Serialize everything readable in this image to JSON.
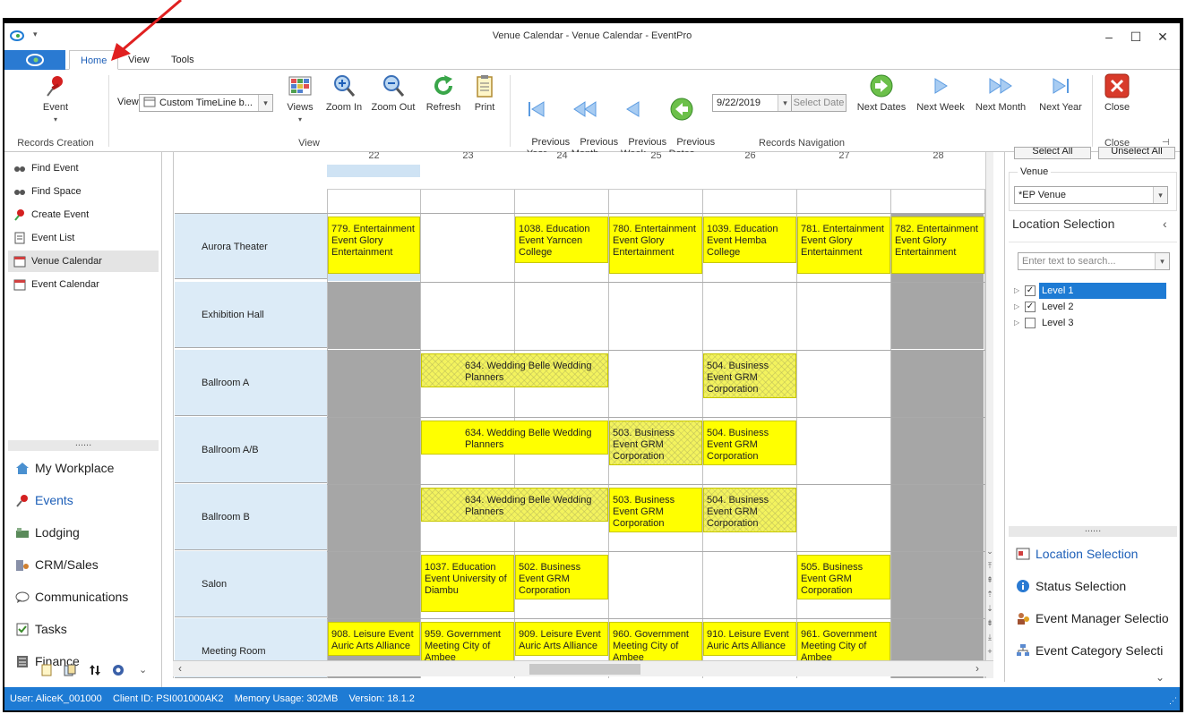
{
  "window": {
    "title": "Venue Calendar - Venue Calendar - EventPro"
  },
  "ribbon_tabs": [
    {
      "label": "Home"
    },
    {
      "label": "View"
    },
    {
      "label": "Tools"
    }
  ],
  "ribbon": {
    "event_label": "Event",
    "records_creation_label": "Records Creation",
    "view_label": "View",
    "view_combo_value": "Custom TimeLine b...",
    "views_label": "Views",
    "zoom_in_label": "Zoom In",
    "zoom_out_label": "Zoom Out",
    "refresh_label": "Refresh",
    "print_label": "Print",
    "view_group_label": "View",
    "prev_year_label": "Previous\nYear",
    "prev_month_label": "Previous\nMonth",
    "prev_week_label": "Previous\nWeek",
    "prev_dates_label": "Previous\nDates",
    "date_value": "9/22/2019",
    "select_date_label": "Select Date",
    "next_dates_label": "Next Dates",
    "next_week_label": "Next Week",
    "next_month_label": "Next Month",
    "next_year_label": "Next Year",
    "records_nav_label": "Records Navigation",
    "close_label": "Close",
    "close_group_label": "Close"
  },
  "left_nav": {
    "items": [
      {
        "label": "Find Event",
        "icon": "binoculars-icon"
      },
      {
        "label": "Find Space",
        "icon": "binoculars-icon"
      },
      {
        "label": "Create Event",
        "icon": "create-event-icon"
      },
      {
        "label": "Event List",
        "icon": "list-icon"
      },
      {
        "label": "Venue Calendar",
        "icon": "calendar-icon"
      },
      {
        "label": "Event Calendar",
        "icon": "calendar-icon"
      }
    ],
    "splitter": "......",
    "modules": [
      {
        "label": "My Workplace",
        "icon": "home-icon"
      },
      {
        "label": "Events",
        "icon": "pushpin-icon"
      },
      {
        "label": "Lodging",
        "icon": "lodging-icon"
      },
      {
        "label": "CRM/Sales",
        "icon": "crm-icon"
      },
      {
        "label": "Communications",
        "icon": "speech-icon"
      },
      {
        "label": "Tasks",
        "icon": "clipboard-icon"
      },
      {
        "label": "Finance",
        "icon": "finance-icon"
      }
    ]
  },
  "calendar": {
    "days": [
      "22",
      "23",
      "24",
      "25",
      "26",
      "27",
      "28"
    ],
    "rooms": [
      "Aurora Theater",
      "Exhibition Hall",
      "Ballroom A",
      "Ballroom A/B",
      "Ballroom B",
      "Salon",
      "Meeting Room"
    ],
    "events": {
      "e779": "779. Entertainment Event Glory Entertainment",
      "e1038": "1038. Education Event Yarncen College",
      "e780": "780. Entertainment Event Glory Entertainment",
      "e1039": "1039. Education Event Hemba College",
      "e781": "781. Entertainment Event Glory Entertainment",
      "e782": "782. Entertainment Event Glory Entertainment",
      "e634a": "634. Wedding Belle Wedding Planners",
      "e504a": "504. Business Event GRM Corporation",
      "e634b": "634. Wedding Belle Wedding Planners",
      "e503b": "503. Business Event GRM Corporation",
      "e504b": "504. Business Event GRM Corporation",
      "e634c": "634. Wedding Belle Wedding Planners",
      "e503c": "503. Business Event GRM Corporation",
      "e504c": "504. Business Event GRM Corporation",
      "e1037": "1037. Education Event University of Diambu",
      "e502": "502. Business Event GRM Corporation",
      "e505": "505. Business Event GRM Corporation",
      "e908": "908. Leisure Event Auric Arts Alliance",
      "e959": "959. Government Meeting City of Ambee",
      "e909": "909. Leisure Event Auric Arts Alliance",
      "e960": "960. Government Meeting City of Ambee",
      "e910": "910. Leisure Event Auric Arts Alliance",
      "e961": "961. Government Meeting City of Ambee"
    }
  },
  "right_panel": {
    "select_all": "Select All",
    "unselect_all": "Unselect All",
    "venue_label": "Venue",
    "venue_value": "*EP Venue",
    "location_selection_title": "Location Selection",
    "search_placeholder": "Enter text to search...",
    "levels": [
      {
        "label": "Level 1",
        "checked": true
      },
      {
        "label": "Level 2",
        "checked": true
      },
      {
        "label": "Level 3",
        "checked": false
      }
    ],
    "splitter": "......",
    "sections": [
      {
        "label": "Location Selection",
        "icon": "location-icon"
      },
      {
        "label": "Status Selection",
        "icon": "info-icon"
      },
      {
        "label": "Event Manager Selectio",
        "icon": "manager-icon"
      },
      {
        "label": "Event Category Selecti",
        "icon": "category-icon"
      }
    ]
  },
  "status_bar": {
    "user": "User: AliceK_001000",
    "client": "Client ID: PSI001000AK2",
    "memory": "Memory Usage: 302MB",
    "version": "Version: 18.1.2"
  },
  "colors": {
    "accent": "#1e7bd4",
    "event_yellow": "#ffff00",
    "room_header": "#dcebf7",
    "unavailable": "#a6a6a6",
    "annotation_arrow": "#e02020"
  }
}
